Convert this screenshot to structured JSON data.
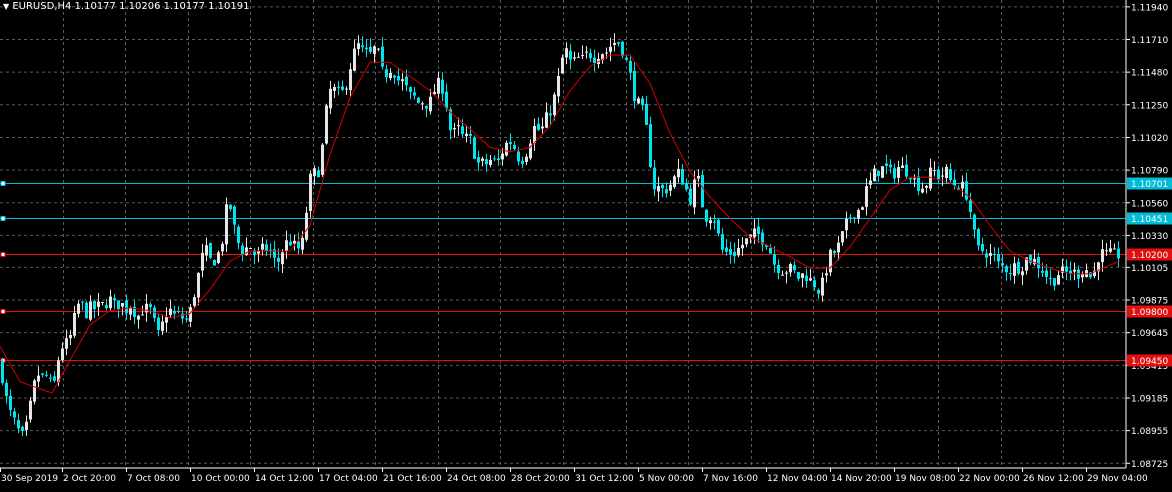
{
  "header": {
    "arrow_glyph": "▼",
    "symbol": "EURUSD,H4",
    "ohlc": "1.10177 1.10206 1.10177 1.10191"
  },
  "colors": {
    "background": "#000000",
    "grid": "#5a5a5a",
    "bull": "#e6e6e6",
    "bear": "#00e5ee",
    "ma_line": "#d40000",
    "support_resistance_cyan": "#00bcd4",
    "support_resistance_red": "#e01010",
    "axis_text": "#ffffff"
  },
  "chart_data": {
    "type": "candlestick",
    "price_axis_ticks": [
      "1.11940",
      "1.11710",
      "1.11480",
      "1.11250",
      "1.11020",
      "1.10790",
      "1.10560",
      "1.10330",
      "1.10105",
      "1.09875",
      "1.09645",
      "1.09415",
      "1.09185",
      "1.08955",
      "1.08725"
    ],
    "time_axis_labels": [
      "30 Sep 2019",
      "2 Oct 20:00",
      "7 Oct 08:00",
      "10 Oct 00:00",
      "14 Oct 12:00",
      "17 Oct 04:00",
      "21 Oct 16:00",
      "24 Oct 08:00",
      "28 Oct 20:00",
      "31 Oct 12:00",
      "5 Nov 00:00",
      "7 Nov 16:00",
      "12 Nov 04:00",
      "14 Nov 20:00",
      "19 Nov 08:00",
      "22 Nov 00:00",
      "26 Nov 12:00",
      "29 Nov 04:00"
    ],
    "ylim": [
      1.0872,
      1.1196
    ],
    "levels": [
      {
        "label": "1.10701",
        "value": 1.10701,
        "color": "cyan"
      },
      {
        "label": "1.10451",
        "value": 1.10451,
        "color": "cyan"
      },
      {
        "label": "1.10200",
        "value": 1.102,
        "color": "red"
      },
      {
        "label": "1.09800",
        "value": 1.098,
        "color": "red"
      },
      {
        "label": "1.09450",
        "value": 1.0945,
        "color": "red"
      }
    ],
    "close_path": [
      [
        0,
        1.0943
      ],
      [
        4,
        1.0925
      ],
      [
        8,
        1.091
      ],
      [
        12,
        1.0905
      ],
      [
        16,
        1.0898
      ],
      [
        20,
        1.0892
      ],
      [
        24,
        1.089
      ],
      [
        28,
        1.0905
      ],
      [
        32,
        1.092
      ],
      [
        36,
        1.0935
      ],
      [
        40,
        1.0935
      ],
      [
        44,
        1.093
      ],
      [
        48,
        1.0938
      ],
      [
        52,
        1.0918
      ],
      [
        56,
        1.094
      ],
      [
        60,
        1.0952
      ],
      [
        64,
        1.0958
      ],
      [
        68,
        1.0955
      ],
      [
        72,
        1.0968
      ],
      [
        76,
        1.098
      ],
      [
        80,
        1.0988
      ],
      [
        84,
        1.0978
      ],
      [
        88,
        1.098
      ],
      [
        92,
        1.0983
      ],
      [
        96,
        1.098
      ],
      [
        100,
        1.0985
      ],
      [
        104,
        1.0982
      ],
      [
        108,
        1.099
      ],
      [
        112,
        1.0985
      ],
      [
        116,
        1.0982
      ],
      [
        120,
        1.0988
      ],
      [
        124,
        1.098
      ],
      [
        128,
        1.0983
      ],
      [
        132,
        1.0985
      ],
      [
        136,
        1.0975
      ],
      [
        140,
        1.0978
      ],
      [
        144,
        1.0984
      ],
      [
        148,
        1.0978
      ],
      [
        152,
        1.0982
      ],
      [
        156,
        1.096
      ],
      [
        160,
        1.0965
      ],
      [
        164,
        1.0975
      ],
      [
        168,
        1.0982
      ],
      [
        172,
        1.0978
      ],
      [
        176,
        1.0975
      ],
      [
        180,
        1.0978
      ],
      [
        184,
        1.0972
      ],
      [
        188,
        1.0975
      ],
      [
        192,
        1.0985
      ],
      [
        196,
        1.1
      ],
      [
        200,
        1.101
      ],
      [
        204,
        1.1025
      ],
      [
        208,
        1.1018
      ],
      [
        212,
        1.1012
      ],
      [
        216,
        1.102
      ],
      [
        220,
        1.102
      ],
      [
        224,
        1.104
      ],
      [
        228,
        1.106
      ],
      [
        232,
        1.1045
      ],
      [
        236,
        1.103
      ],
      [
        240,
        1.1025
      ],
      [
        244,
        1.102
      ],
      [
        248,
        1.1028
      ],
      [
        252,
        1.1022
      ],
      [
        256,
        1.1018
      ],
      [
        260,
        1.102
      ],
      [
        264,
        1.1025
      ],
      [
        268,
        1.1022
      ],
      [
        272,
        1.102
      ],
      [
        276,
        1.101
      ],
      [
        280,
        1.102
      ],
      [
        284,
        1.1025
      ],
      [
        288,
        1.103
      ],
      [
        292,
        1.1028
      ],
      [
        296,
        1.1022
      ],
      [
        300,
        1.1025
      ],
      [
        304,
        1.103
      ],
      [
        308,
        1.107
      ],
      [
        312,
        1.1075
      ],
      [
        316,
        1.1078
      ],
      [
        320,
        1.108
      ],
      [
        324,
        1.111
      ],
      [
        328,
        1.113
      ],
      [
        332,
        1.114
      ],
      [
        336,
        1.113
      ],
      [
        340,
        1.1135
      ],
      [
        344,
        1.1132
      ],
      [
        348,
        1.115
      ],
      [
        352,
        1.1155
      ],
      [
        356,
        1.1168
      ],
      [
        360,
        1.1165
      ],
      [
        364,
        1.116
      ],
      [
        368,
        1.1162
      ],
      [
        372,
        1.1158
      ],
      [
        376,
        1.117
      ],
      [
        380,
        1.115
      ],
      [
        384,
        1.1145
      ],
      [
        388,
        1.115
      ],
      [
        392,
        1.1152
      ],
      [
        396,
        1.1145
      ],
      [
        400,
        1.114
      ],
      [
        404,
        1.1142
      ],
      [
        408,
        1.113
      ],
      [
        412,
        1.1132
      ],
      [
        416,
        1.1128
      ],
      [
        420,
        1.1125
      ],
      [
        424,
        1.113
      ],
      [
        428,
        1.1122
      ],
      [
        432,
        1.1132
      ],
      [
        436,
        1.1138
      ],
      [
        440,
        1.114
      ],
      [
        444,
        1.1135
      ],
      [
        448,
        1.1115
      ],
      [
        452,
        1.11
      ],
      [
        456,
        1.111
      ],
      [
        460,
        1.1105
      ],
      [
        464,
        1.11
      ],
      [
        468,
        1.1102
      ],
      [
        472,
        1.1098
      ],
      [
        476,
        1.1085
      ],
      [
        480,
        1.1082
      ],
      [
        484,
        1.1085
      ],
      [
        488,
        1.1082
      ],
      [
        492,
        1.109
      ],
      [
        496,
        1.108
      ],
      [
        500,
        1.109
      ],
      [
        504,
        1.1095
      ],
      [
        508,
        1.11
      ],
      [
        512,
        1.1098
      ],
      [
        516,
        1.1092
      ],
      [
        520,
        1.1085
      ],
      [
        524,
        1.109
      ],
      [
        528,
        1.1095
      ],
      [
        532,
        1.1108
      ],
      [
        536,
        1.111
      ],
      [
        540,
        1.1105
      ],
      [
        544,
        1.1112
      ],
      [
        548,
        1.1118
      ],
      [
        552,
        1.1125
      ],
      [
        556,
        1.1135
      ],
      [
        560,
        1.115
      ],
      [
        564,
        1.1165
      ],
      [
        568,
        1.116
      ],
      [
        572,
        1.115
      ],
      [
        576,
        1.116
      ],
      [
        580,
        1.1155
      ],
      [
        584,
        1.1158
      ],
      [
        588,
        1.1162
      ],
      [
        592,
        1.116
      ],
      [
        596,
        1.1158
      ],
      [
        600,
        1.1165
      ],
      [
        604,
        1.116
      ],
      [
        608,
        1.1165
      ],
      [
        612,
        1.1168
      ],
      [
        616,
        1.117
      ],
      [
        620,
        1.1168
      ],
      [
        624,
        1.116
      ],
      [
        628,
        1.115
      ],
      [
        632,
        1.114
      ],
      [
        636,
        1.1125
      ],
      [
        640,
        1.1125
      ],
      [
        644,
        1.1115
      ],
      [
        648,
        1.11
      ],
      [
        652,
        1.107
      ],
      [
        656,
        1.1065
      ],
      [
        660,
        1.1068
      ],
      [
        664,
        1.1062
      ],
      [
        668,
        1.107
      ],
      [
        672,
        1.1068
      ],
      [
        676,
        1.1078
      ],
      [
        680,
        1.1075
      ],
      [
        684,
        1.107
      ],
      [
        688,
        1.106
      ],
      [
        692,
        1.1058
      ],
      [
        696,
        1.108
      ],
      [
        700,
        1.1062
      ],
      [
        704,
        1.1048
      ],
      [
        708,
        1.1045
      ],
      [
        712,
        1.105
      ],
      [
        716,
        1.104
      ],
      [
        720,
        1.1025
      ],
      [
        724,
        1.102
      ],
      [
        728,
        1.1022
      ],
      [
        732,
        1.102
      ],
      [
        736,
        1.1022
      ],
      [
        740,
        1.1025
      ],
      [
        744,
        1.1028
      ],
      [
        748,
        1.103
      ],
      [
        752,
        1.1032
      ],
      [
        756,
        1.1035
      ],
      [
        760,
        1.1032
      ],
      [
        764,
        1.103
      ],
      [
        768,
        1.1028
      ],
      [
        772,
        1.1015
      ],
      [
        776,
        1.1012
      ],
      [
        780,
        1.101
      ],
      [
        784,
        1.1008
      ],
      [
        788,
        1.101
      ],
      [
        792,
        1.1008
      ],
      [
        796,
        1.1005
      ],
      [
        800,
        1.1002
      ],
      [
        804,
        1.1008
      ],
      [
        808,
        1.1002
      ],
      [
        812,
        1.1
      ],
      [
        816,
        1.0998
      ],
      [
        820,
        1.0992
      ],
      [
        824,
        1.1005
      ],
      [
        828,
        1.1015
      ],
      [
        832,
        1.1022
      ],
      [
        836,
        1.102
      ],
      [
        840,
        1.103
      ],
      [
        844,
        1.1035
      ],
      [
        848,
        1.1045
      ],
      [
        852,
        1.1048
      ],
      [
        856,
        1.1052
      ],
      [
        860,
        1.105
      ],
      [
        864,
        1.1062
      ],
      [
        868,
        1.1068
      ],
      [
        872,
        1.1072
      ],
      [
        876,
        1.108
      ],
      [
        880,
        1.1078
      ],
      [
        884,
        1.1082
      ],
      [
        888,
        1.1078
      ],
      [
        892,
        1.1075
      ],
      [
        896,
        1.108
      ],
      [
        900,
        1.1082
      ],
      [
        904,
        1.1078
      ],
      [
        908,
        1.108
      ],
      [
        912,
        1.1075
      ],
      [
        916,
        1.1068
      ],
      [
        920,
        1.107
      ],
      [
        924,
        1.1065
      ],
      [
        928,
        1.1075
      ],
      [
        932,
        1.1078
      ],
      [
        936,
        1.1078
      ],
      [
        940,
        1.1072
      ],
      [
        944,
        1.108
      ],
      [
        948,
        1.1075
      ],
      [
        952,
        1.1068
      ],
      [
        956,
        1.107
      ],
      [
        960,
        1.1068
      ],
      [
        964,
        1.1065
      ],
      [
        968,
        1.106
      ],
      [
        972,
        1.104
      ],
      [
        976,
        1.1025
      ],
      [
        980,
        1.102
      ],
      [
        984,
        1.1025
      ],
      [
        988,
        1.1018
      ],
      [
        992,
        1.102
      ],
      [
        996,
        1.1015
      ],
      [
        1000,
        1.101
      ],
      [
        1004,
        1.1012
      ],
      [
        1008,
        1.1008
      ],
      [
        1012,
        1.101
      ],
      [
        1016,
        1.1012
      ],
      [
        1020,
        1.101
      ],
      [
        1024,
        1.1015
      ],
      [
        1028,
        1.1018
      ],
      [
        1032,
        1.1015
      ],
      [
        1036,
        1.1015
      ],
      [
        1040,
        1.101
      ],
      [
        1044,
        1.1008
      ],
      [
        1048,
        1.1002
      ],
      [
        1052,
        1.1
      ],
      [
        1056,
        1.1005
      ],
      [
        1060,
        1.1008
      ],
      [
        1064,
        1.1005
      ],
      [
        1068,
        1.1008
      ],
      [
        1072,
        1.1008
      ],
      [
        1076,
        1.1005
      ],
      [
        1080,
        1.1008
      ],
      [
        1084,
        1.101
      ],
      [
        1088,
        1.1008
      ],
      [
        1092,
        1.1
      ],
      [
        1096,
        1.1015
      ],
      [
        1100,
        1.1022
      ],
      [
        1104,
        1.1018
      ],
      [
        1108,
        1.102
      ],
      [
        1112,
        1.1018
      ],
      [
        1116,
        1.102
      ],
      [
        1120,
        1.1019
      ]
    ],
    "ma_path": [
      [
        0,
        1.0955
      ],
      [
        20,
        1.093
      ],
      [
        40,
        1.0925
      ],
      [
        52,
        1.0922
      ],
      [
        70,
        1.0945
      ],
      [
        90,
        1.097
      ],
      [
        110,
        1.098
      ],
      [
        130,
        1.0982
      ],
      [
        150,
        1.098
      ],
      [
        170,
        1.0975
      ],
      [
        190,
        1.0978
      ],
      [
        210,
        1.0995
      ],
      [
        230,
        1.1015
      ],
      [
        250,
        1.1022
      ],
      [
        270,
        1.1022
      ],
      [
        290,
        1.1022
      ],
      [
        310,
        1.104
      ],
      [
        330,
        1.109
      ],
      [
        350,
        1.113
      ],
      [
        370,
        1.1155
      ],
      [
        390,
        1.1155
      ],
      [
        410,
        1.1145
      ],
      [
        430,
        1.1135
      ],
      [
        450,
        1.112
      ],
      [
        470,
        1.1108
      ],
      [
        490,
        1.1095
      ],
      [
        510,
        1.1092
      ],
      [
        530,
        1.1095
      ],
      [
        550,
        1.111
      ],
      [
        570,
        1.1135
      ],
      [
        590,
        1.1152
      ],
      [
        610,
        1.116
      ],
      [
        630,
        1.116
      ],
      [
        650,
        1.114
      ],
      [
        670,
        1.1105
      ],
      [
        690,
        1.1078
      ],
      [
        710,
        1.106
      ],
      [
        730,
        1.1045
      ],
      [
        750,
        1.1032
      ],
      [
        770,
        1.1025
      ],
      [
        790,
        1.1018
      ],
      [
        810,
        1.101
      ],
      [
        830,
        1.101
      ],
      [
        850,
        1.1025
      ],
      [
        870,
        1.1045
      ],
      [
        890,
        1.1065
      ],
      [
        910,
        1.1074
      ],
      [
        930,
        1.1074
      ],
      [
        950,
        1.107
      ],
      [
        970,
        1.106
      ],
      [
        990,
        1.104
      ],
      [
        1010,
        1.1022
      ],
      [
        1030,
        1.1015
      ],
      [
        1050,
        1.101
      ],
      [
        1070,
        1.1006
      ],
      [
        1090,
        1.1006
      ],
      [
        1110,
        1.1012
      ],
      [
        1120,
        1.1015
      ]
    ]
  }
}
